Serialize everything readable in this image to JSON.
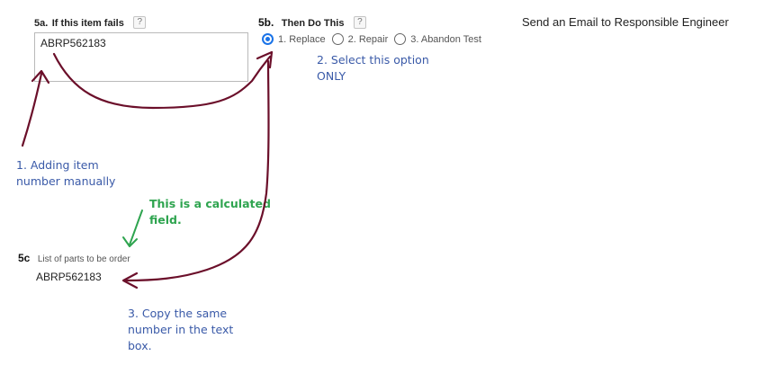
{
  "section_5a": {
    "number": "5a.",
    "label": "If this item fails",
    "help": "?",
    "value": "ABRP562183"
  },
  "section_5b": {
    "number": "5b.",
    "label": "Then Do This",
    "help": "?",
    "options": [
      {
        "label": "1. Replace",
        "selected": true
      },
      {
        "label": "2. Repair",
        "selected": false
      },
      {
        "label": "3. Abandon Test",
        "selected": false
      }
    ]
  },
  "email_action": "Send an Email to Responsible Engineer",
  "section_5c": {
    "number": "5c",
    "label": "List of parts to be order",
    "value": "ABRP562183"
  },
  "annotations": {
    "step1": [
      "1. Adding item",
      "number manually"
    ],
    "step2": [
      "2. Select this option",
      "ONLY"
    ],
    "step3": [
      "3. Copy the same",
      "number in the text",
      "box."
    ],
    "calculated": [
      "This is a calculated",
      "field."
    ]
  },
  "colors": {
    "arrow": "#6b0f2a",
    "annotation_blue": "#3a5aa8",
    "annotation_green": "#2ea44f",
    "radio_accent": "#1a73e8"
  }
}
